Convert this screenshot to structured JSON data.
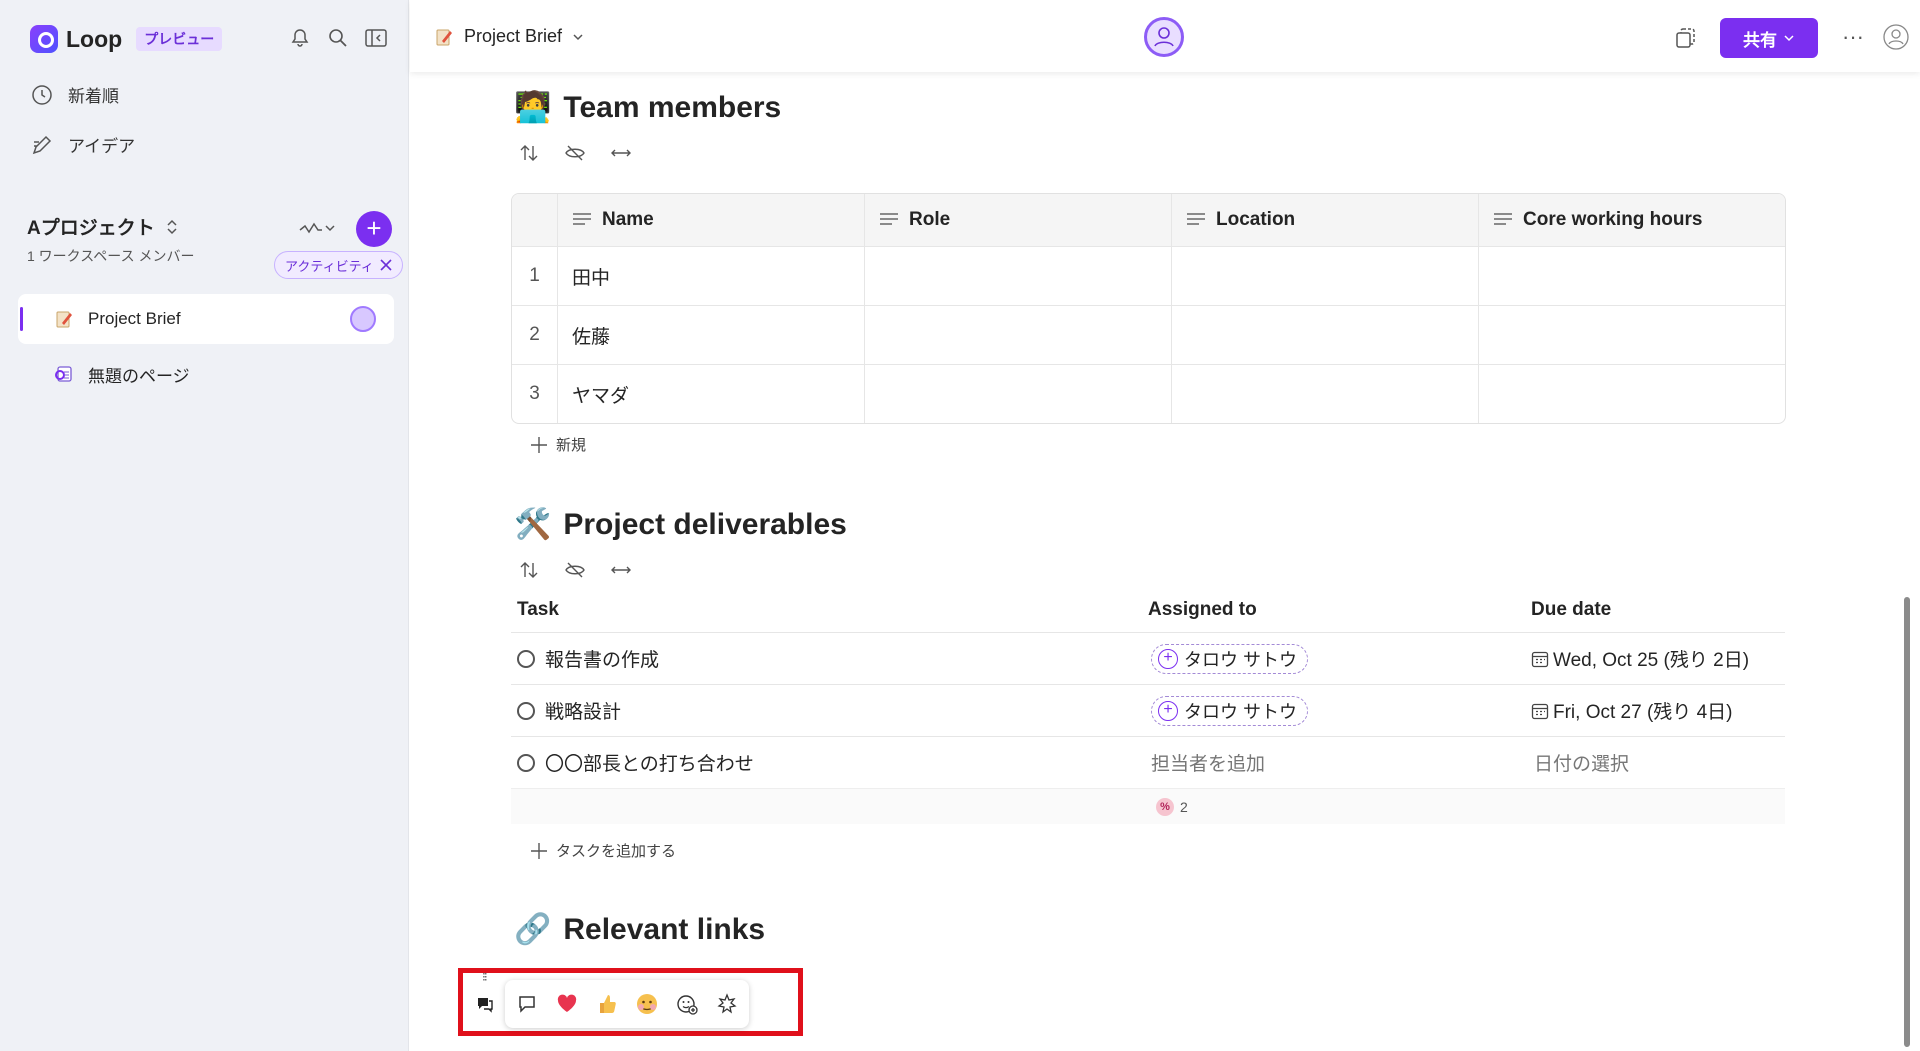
{
  "sidebar": {
    "app_name": "Loop",
    "preview_badge": "プレビュー",
    "nav": [
      {
        "label": "新着順",
        "icon": "clock-icon"
      },
      {
        "label": "アイデア",
        "icon": "idea-pen-icon"
      }
    ],
    "workspace": {
      "title": "Aプロジェクト",
      "subtitle": "1 ワークスペース メンバー",
      "activity_chip": "アクティビティ"
    },
    "pages": [
      {
        "label": "Project Brief",
        "active": true
      },
      {
        "label": "無題のページ",
        "active": false
      }
    ]
  },
  "topbar": {
    "doc_title": "Project Brief",
    "share_label": "共有",
    "more": "···"
  },
  "team": {
    "title": "Team members",
    "emoji": "🧑‍💻",
    "columns": [
      "Name",
      "Role",
      "Location",
      "Core working hours"
    ],
    "rows": [
      {
        "num": "1",
        "name": "田中"
      },
      {
        "num": "2",
        "name": "佐藤"
      },
      {
        "num": "3",
        "name": "ヤマダ"
      }
    ],
    "new_label": "新規"
  },
  "deliverables": {
    "title": "Project deliverables",
    "emoji": "🛠️",
    "columns": {
      "task": "Task",
      "assigned": "Assigned to",
      "due": "Due date"
    },
    "rows": [
      {
        "task": "報告書の作成",
        "assignee": "タロウ サトウ",
        "due": "Wed, Oct 25 (残り 2日)"
      },
      {
        "task": "戦略設計",
        "assignee": "タロウ サトウ",
        "due": "Fri, Oct 27 (残り 4日)"
      },
      {
        "task": "〇〇部長との打ち合わせ",
        "assignee_placeholder": "担当者を追加",
        "due_placeholder": "日付の選択"
      }
    ],
    "summary_count": "2",
    "add_task_label": "タスクを追加する"
  },
  "links": {
    "title": "Relevant links",
    "emoji": "🔗"
  },
  "reactions": [
    "comment-icon",
    "heart-emoji",
    "thumbs-up-emoji",
    "thinking-emoji",
    "add-reaction-icon",
    "celebrate-icon"
  ],
  "colors": {
    "accent": "#7b2ff0",
    "highlight_box": "#e0101b"
  }
}
